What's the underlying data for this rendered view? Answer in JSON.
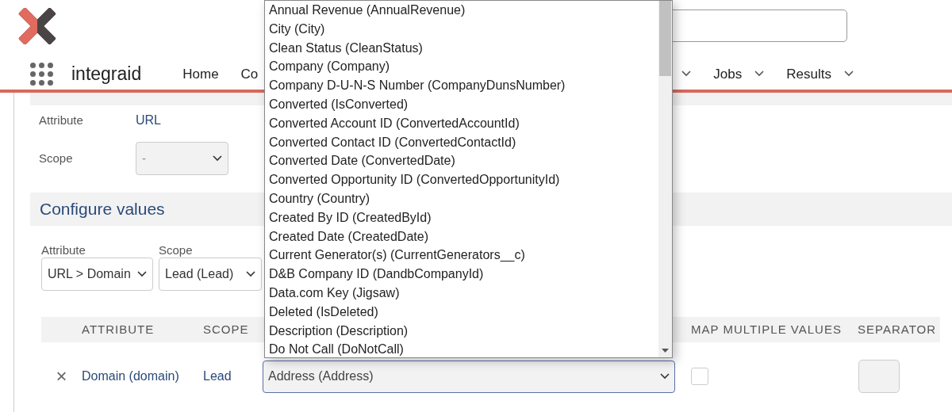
{
  "header": {
    "brand": "integraid",
    "nav": [
      {
        "kind": "link",
        "label": "Home"
      },
      {
        "kind": "link",
        "label": "Co"
      },
      {
        "kind": "caret"
      },
      {
        "kind": "menu",
        "label": "Jobs"
      },
      {
        "kind": "menu",
        "label": "Results"
      }
    ]
  },
  "attribute_info": {
    "attribute_label": "Attribute",
    "attribute_value": "URL",
    "scope_label": "Scope",
    "scope_value": "-"
  },
  "configure_values": {
    "title": "Configure values",
    "attribute_label": "Attribute",
    "attribute_value": "URL > Domain",
    "scope_label": "Scope",
    "scope_value": "Lead (Lead)",
    "table": {
      "columns": [
        "ATTRIBUTE",
        "SCOPE",
        "MAP MULTIPLE VALUES",
        "SEPARATOR"
      ],
      "rows": [
        {
          "remove": "×",
          "attribute": "Domain (domain)",
          "scope": "Lead",
          "field": "Address (Address)",
          "map_multiple": false
        }
      ]
    }
  },
  "dropdown": {
    "options": [
      {
        "label": "Annual Revenue (AnnualRevenue)",
        "selected": false
      },
      {
        "label": "City (City)",
        "selected": false
      },
      {
        "label": "Clean Status (CleanStatus)",
        "selected": false
      },
      {
        "label": "Company (Company)",
        "selected": false
      },
      {
        "label": "Company D-U-N-S Number (CompanyDunsNumber)",
        "selected": false
      },
      {
        "label": "Converted (IsConverted)",
        "selected": false
      },
      {
        "label": "Converted Account ID (ConvertedAccountId)",
        "selected": false
      },
      {
        "label": "Converted Contact ID (ConvertedContactId)",
        "selected": false
      },
      {
        "label": "Converted Date (ConvertedDate)",
        "selected": false
      },
      {
        "label": "Converted Opportunity ID (ConvertedOpportunityId)",
        "selected": false
      },
      {
        "label": "Country (Country)",
        "selected": false
      },
      {
        "label": "Created By ID (CreatedById)",
        "selected": false
      },
      {
        "label": "Created Date (CreatedDate)",
        "selected": false
      },
      {
        "label": "Current Generator(s) (CurrentGenerators__c)",
        "selected": false
      },
      {
        "label": "D&B Company ID (DandbCompanyId)",
        "selected": false
      },
      {
        "label": "Data.com Key (Jigsaw)",
        "selected": false
      },
      {
        "label": "Deleted (IsDeleted)",
        "selected": false
      },
      {
        "label": "Description (Description)",
        "selected": false
      },
      {
        "label": "Do Not Call (DoNotCall)",
        "selected": false
      }
    ]
  }
}
